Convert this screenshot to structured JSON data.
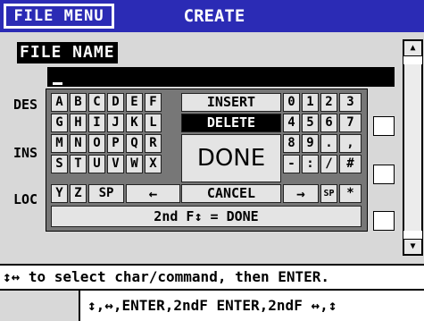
{
  "header": {
    "menu_tab": "FILE MENU",
    "title": "CREATE"
  },
  "form": {
    "file_name_label": "FILE NAME",
    "rows": [
      {
        "label": "DES"
      },
      {
        "label": "INS"
      },
      {
        "label": "LOC"
      }
    ]
  },
  "keyboard": {
    "letters": {
      "row1": [
        "A",
        "B",
        "C",
        "D",
        "E",
        "F"
      ],
      "row2": [
        "G",
        "H",
        "I",
        "J",
        "K",
        "L"
      ],
      "row3": [
        "M",
        "N",
        "O",
        "P",
        "Q",
        "R"
      ],
      "row4": [
        "S",
        "T",
        "U",
        "V",
        "W",
        "X"
      ],
      "row5": [
        "Y",
        "Z",
        "SP",
        "←"
      ]
    },
    "commands": {
      "insert": "INSERT",
      "delete": "DELETE",
      "done": "DONE",
      "cancel": "CANCEL"
    },
    "digits": {
      "row1": [
        "0",
        "1",
        "2",
        "3"
      ],
      "row2": [
        "4",
        "5",
        "6",
        "7"
      ],
      "row3": [
        "8",
        "9",
        ".",
        ","
      ],
      "row4": [
        "-",
        ":",
        "/",
        "#"
      ],
      "row5": [
        "→",
        "SP",
        "*"
      ]
    },
    "footer": "2nd F↕ = DONE",
    "selected": "DELETE"
  },
  "status": {
    "instruction": "↕↔ to select char/command, then ENTER.",
    "hints": "↕,↔,ENTER,2ndF ENTER,2ndF ↔,↕"
  },
  "colors": {
    "title_bar": "#2b2bb5",
    "background": "#d8d8d8",
    "selected_key": "#000000"
  }
}
